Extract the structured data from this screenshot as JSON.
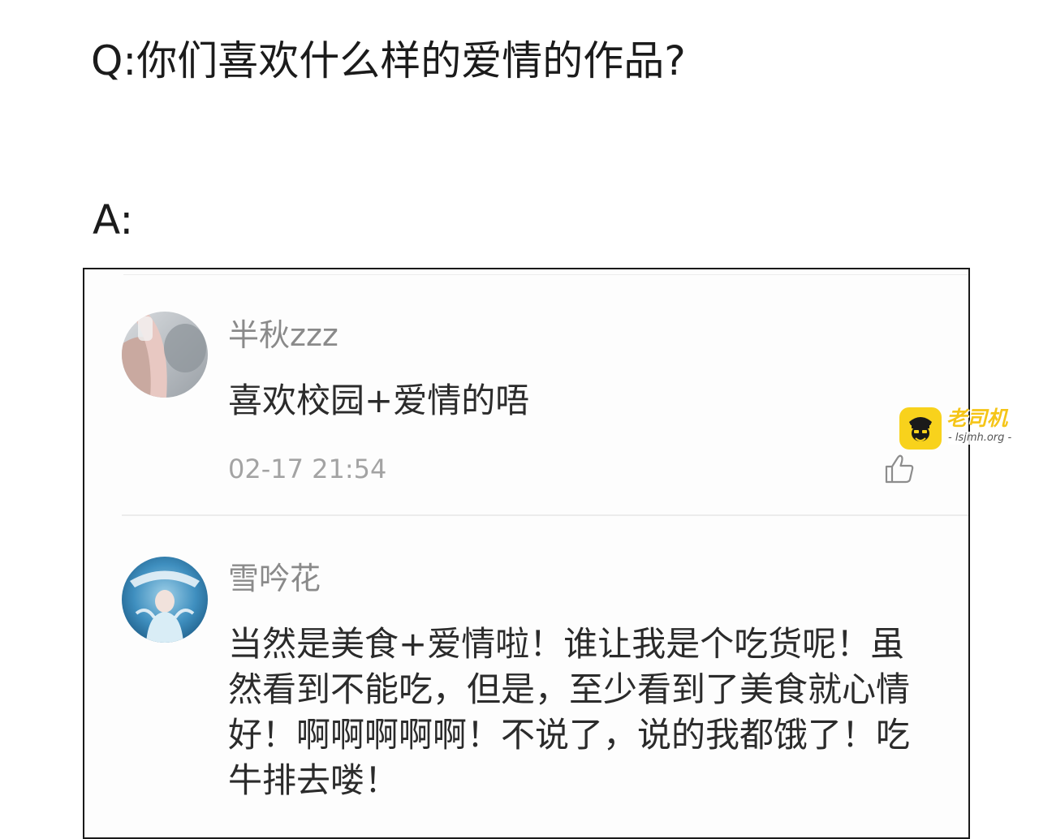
{
  "question": "Q:你们喜欢什么样的爱情的作品?",
  "answer_label": "A:",
  "comments": [
    {
      "username": "半秋zzz",
      "text": "喜欢校园+爱情的唔",
      "timestamp": "02-17 21:54",
      "avatar_icon": "user-avatar-photo"
    },
    {
      "username": "雪吟花",
      "text": "当然是美食+爱情啦！谁让我是个吃货呢！虽然看到不能吃，但是，至少看到了美食就心情好！啊啊啊啊啊！不说了，说的我都饿了！吃牛排去喽！",
      "avatar_icon": "user-avatar-photo"
    }
  ],
  "watermark": {
    "title": "老司机",
    "url": "- lsjmh.org -",
    "accent_color": "#f8d21c"
  },
  "like_icon": "thumbs-up-icon"
}
